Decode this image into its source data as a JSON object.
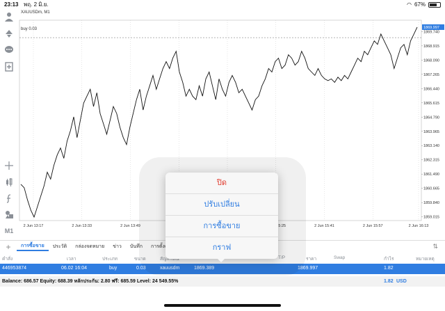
{
  "status_bar": {
    "time": "23:13",
    "date": "พฤ. 2 มิ.ย.",
    "battery": "67%"
  },
  "chart": {
    "symbol_label": "XAUUSDm, M1",
    "buy_line_label": "buy 0.03",
    "current_price": "1869.997",
    "accent_color": "#2f7de1"
  },
  "chart_data": {
    "type": "line",
    "title": "XAUUSDm, M1",
    "xlabel": "",
    "ylabel": "",
    "ylim": [
      1858.8,
      1870.4
    ],
    "x_ticks": [
      "2 Jun 13:17",
      "2 Jun 13:33",
      "2 Jun 13:49",
      "2 Jun 14:05",
      "2 Jun 16:09",
      "2 Jun 15:25",
      "2 Jun 15:41",
      "2 Jun 15:57",
      "2 Jun 16:13"
    ],
    "y_ticks": [
      "1869.740",
      "1868.915",
      "1868.090",
      "1867.265",
      "1866.440",
      "1865.615",
      "1864.790",
      "1863.965",
      "1863.140",
      "1862.315",
      "1861.490",
      "1860.665",
      "1859.840",
      "1859.015"
    ],
    "buy_level": 1869.389,
    "series": [
      {
        "values": [
          1860.9,
          1860.7,
          1860.0,
          1859.4,
          1859.0,
          1859.6,
          1860.2,
          1860.8,
          1861.6,
          1861.2,
          1862.0,
          1862.6,
          1863.0,
          1862.4,
          1863.4,
          1864.0,
          1864.8,
          1863.6,
          1864.6,
          1865.6,
          1866.0,
          1866.4,
          1865.4,
          1866.2,
          1865.0,
          1864.4,
          1863.8,
          1864.6,
          1865.4,
          1865.0,
          1864.2,
          1863.6,
          1863.2,
          1864.2,
          1865.0,
          1865.8,
          1866.4,
          1865.2,
          1866.0,
          1866.6,
          1867.2,
          1866.4,
          1867.0,
          1867.6,
          1868.0,
          1867.6,
          1868.2,
          1868.6,
          1867.4,
          1866.8,
          1866.0,
          1866.4,
          1866.0,
          1865.8,
          1866.6,
          1866.0,
          1867.0,
          1867.4,
          1866.6,
          1865.8,
          1867.0,
          1866.4,
          1866.0,
          1866.8,
          1867.2,
          1866.8,
          1866.2,
          1866.4,
          1866.0,
          1865.6,
          1865.2,
          1865.8,
          1866.0,
          1866.6,
          1867.0,
          1867.6,
          1867.4,
          1868.0,
          1868.2,
          1867.6,
          1867.8,
          1868.4,
          1868.2,
          1867.8,
          1868.0,
          1868.6,
          1868.2,
          1867.6,
          1867.4,
          1867.2,
          1867.6,
          1867.2,
          1867.0,
          1866.9,
          1867.0,
          1866.8,
          1867.1,
          1866.9,
          1867.2,
          1867.0,
          1867.4,
          1867.8,
          1868.2,
          1868.0,
          1868.6,
          1868.4,
          1868.8,
          1869.2,
          1869.0,
          1869.6,
          1869.2,
          1868.8,
          1868.4,
          1867.6,
          1868.2,
          1868.8,
          1869.0,
          1868.4,
          1869.2,
          1869.6,
          1869.997
        ]
      }
    ]
  },
  "tabs": [
    {
      "label": "การซื้อขาย",
      "active": true
    },
    {
      "label": "ประวัติ"
    },
    {
      "label": "กล่องจดหมาย"
    },
    {
      "label": "ข่าว"
    },
    {
      "label": "บันทึก"
    },
    {
      "label": "การตั้งค่า"
    }
  ],
  "table": {
    "headers": [
      "คำสั่ง",
      "เวลา",
      "ประเภท",
      "ขนาด",
      "สัญลักษณ์",
      "S/L",
      "T/P",
      "ราคา",
      "Swap",
      "กำไร",
      "หมายเหตุ"
    ],
    "row": {
      "order": "446953874",
      "time": "06.02 16:04",
      "type": "buy",
      "volume": "0.03",
      "symbol": "xauusdm",
      "open_price": "1869.389",
      "price": "1869.997",
      "profit": "1.82"
    }
  },
  "balance_bar": {
    "text": "Balance: 686.57 Equity: 688.39 หลักประกัน: 2.80 ฟรี: 685.59 Level: 24 549.55%",
    "profit": "1.82",
    "currency": "USD"
  },
  "popover": {
    "close": "ปิด",
    "modify": "ปรับเปลี่ยน",
    "trade": "การซื้อขาย",
    "chart": "กราฟ"
  }
}
